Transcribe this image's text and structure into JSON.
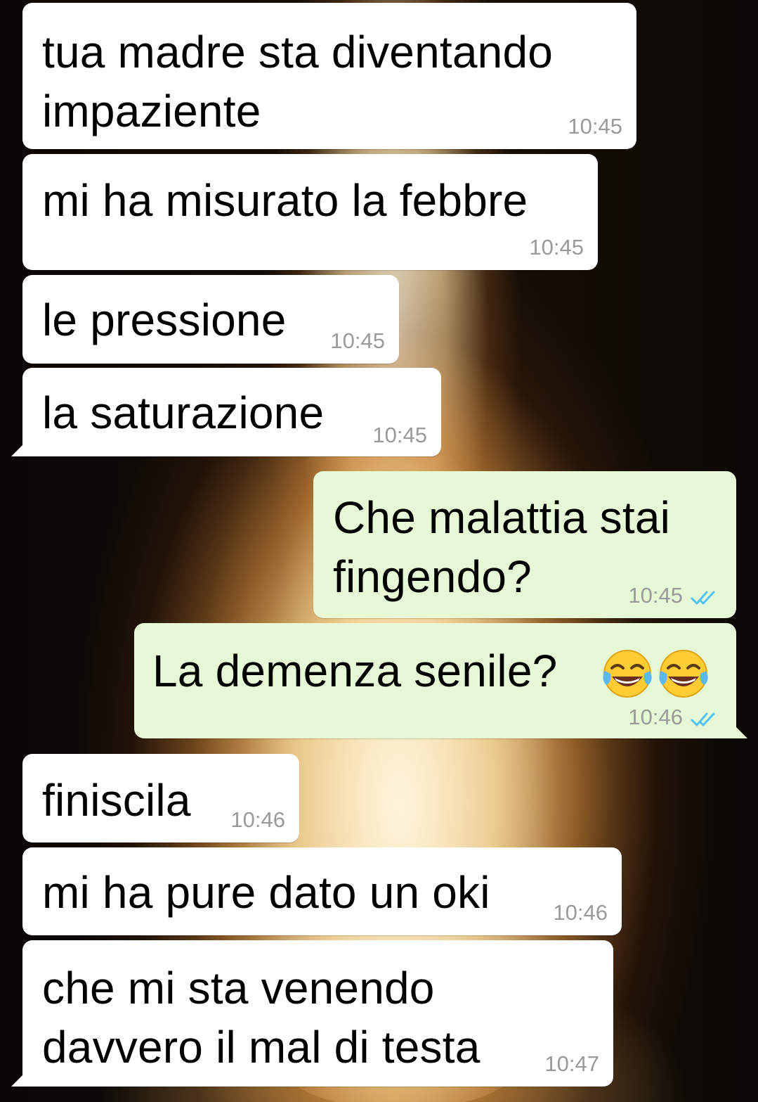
{
  "colors": {
    "incoming_bubble": "#ffffff",
    "outgoing_bubble": "#e6f8d6",
    "timestamp": "#9a9a9a",
    "read_ticks": "#4fc3f7"
  },
  "messages": [
    {
      "direction": "incoming",
      "text": "tua madre sta diventando\nimpaziente",
      "time": "10:45"
    },
    {
      "direction": "incoming",
      "text": "mi ha misurato la febbre",
      "time": "10:45"
    },
    {
      "direction": "incoming",
      "text": "le pressione",
      "time": "10:45"
    },
    {
      "direction": "incoming",
      "text": "la saturazione",
      "time": "10:45"
    },
    {
      "direction": "outgoing",
      "text": "Che malattia stai\nfingendo?",
      "time": "10:45",
      "status_icon": "double-check-read-icon"
    },
    {
      "direction": "outgoing",
      "text": "La demenza senile?",
      "time": "10:46",
      "status_icon": "double-check-read-icon",
      "emoji": [
        "face-with-tears-of-joy-icon",
        "face-with-tears-of-joy-icon"
      ]
    },
    {
      "direction": "incoming",
      "text": "finiscila",
      "time": "10:46"
    },
    {
      "direction": "incoming",
      "text": "mi ha pure dato un oki",
      "time": "10:46"
    },
    {
      "direction": "incoming",
      "text": "che mi sta venendo\ndavvero il mal di testa",
      "time": "10:47"
    }
  ]
}
